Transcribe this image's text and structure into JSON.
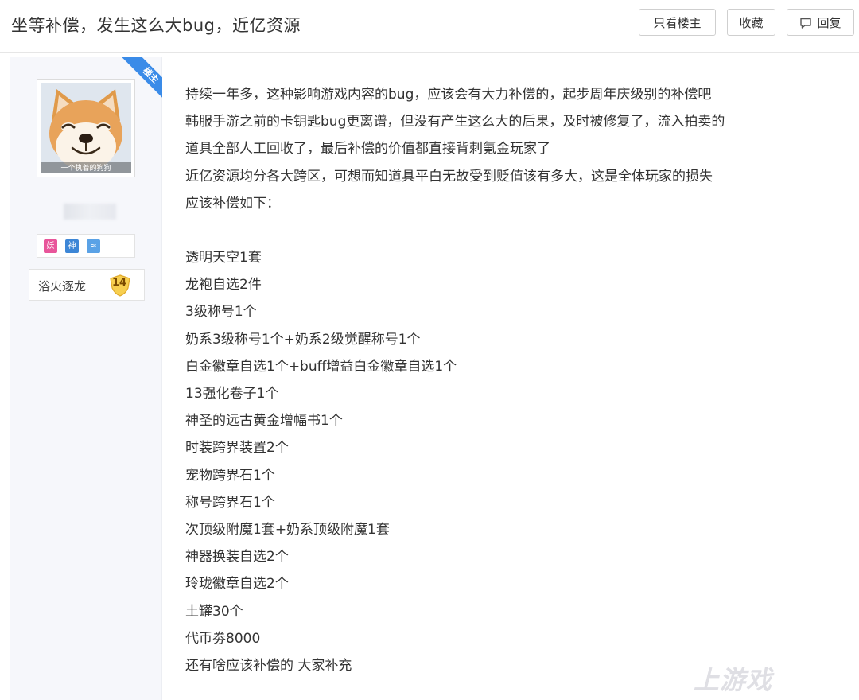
{
  "header": {
    "title": "坐等补偿，发生这么大bug，近亿资源",
    "btn_only_op": "只看楼主",
    "btn_favorite": "收藏",
    "btn_reply": "回复"
  },
  "author": {
    "op_ribbon": "楼主",
    "avatar_caption": "一个执着的狗狗",
    "badges": [
      "妖",
      "神",
      "≈"
    ],
    "level_name": "浴火逐龙",
    "level_num": "14"
  },
  "post": {
    "paragraphs": [
      "持续一年多，这种影响游戏内容的bug，应该会有大力补偿的，起步周年庆级别的补偿吧",
      "韩服手游之前的卡钥匙bug更离谱，但没有产生这么大的后果，及时被修复了，流入拍卖的",
      "道具全部人工回收了，最后补偿的价值都直接背刺氪金玩家了",
      "近亿资源均分各大跨区，可想而知道具平白无故受到贬值该有多大，这是全体玩家的损失",
      "应该补偿如下："
    ],
    "items": [
      "透明天空1套",
      "龙袍自选2件",
      "3级称号1个",
      "奶系3级称号1个+奶系2级觉醒称号1个",
      "白金徽章自选1个+buff增益白金徽章自选1个",
      "13强化卷子1个",
      "神圣的远古黄金增幅书1个",
      "时装跨界装置2个",
      "宠物跨界石1个",
      "称号跨界石1个",
      "次顶级附魔1套+奶系顶级附魔1套",
      "神器换装自选2个",
      "玲珑徽章自选2个",
      "土罐30个",
      "代币劵8000",
      "还有啥应该补偿的 大家补充"
    ]
  },
  "watermark": "上游戏"
}
